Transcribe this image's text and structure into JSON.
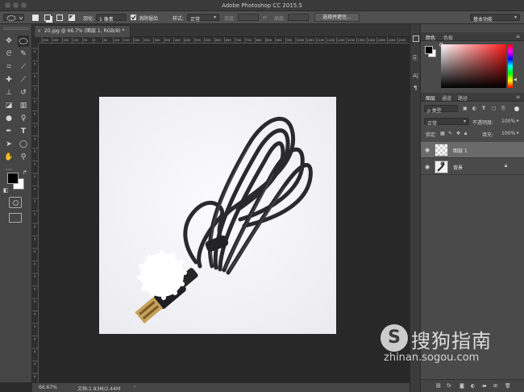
{
  "app": {
    "title": "Adobe Photoshop CC 2015.5"
  },
  "options": {
    "feather_label": "羽化:",
    "feather_value": "1 像素",
    "antialias_label": "消除锯齿",
    "style_label": "样式:",
    "style_value": "正常",
    "width_label": "宽度:",
    "height_label": "高度:",
    "select_mask_button": "选择并遮住...",
    "workspace": "基本功能"
  },
  "document": {
    "tab_title": "20.jpg @ 66.7% (图层 1, RGB/8) *",
    "zoom": "66.67%",
    "doc_info": "文档:1.83M/2.44M"
  },
  "rulers": {
    "top": [
      "250",
      "200",
      "150",
      "100",
      "50",
      "0",
      "50",
      "100",
      "150",
      "200",
      "250",
      "300",
      "350",
      "400",
      "450",
      "500",
      "550",
      "600",
      "650",
      "700",
      "750",
      "800",
      "850",
      "900",
      "950",
      "1000",
      "1050",
      "1100",
      "1150",
      "1200",
      "1250",
      "1300",
      "1350",
      "1400",
      "1450",
      "1500"
    ],
    "left": [
      "0",
      "5",
      "0",
      "1",
      "0",
      "0",
      "1",
      "5",
      "0",
      "2",
      "0",
      "0",
      "2",
      "5",
      "0",
      "3",
      "0",
      "0",
      "3",
      "5",
      "0",
      "4",
      "0",
      "0",
      "4",
      "5",
      "0"
    ]
  },
  "color_panel": {
    "tabs": [
      "颜色",
      "色板"
    ],
    "active": "颜色",
    "foreground": "#000000",
    "background": "#ffffff",
    "hue_color": "#ff1a1a"
  },
  "layers_panel": {
    "tabs": [
      "图层",
      "通道",
      "路径"
    ],
    "filter_label": "ρ 类型",
    "blend_mode": "正常",
    "opacity_label": "不透明度:",
    "opacity_value": "100%",
    "lock_label": "锁定:",
    "fill_label": "填充:",
    "fill_value": "100%",
    "layers": [
      {
        "name": "图层 1",
        "selected": true
      },
      {
        "name": "背景",
        "selected": false,
        "locked": true
      }
    ],
    "footer_icons": [
      "link-icon",
      "fx-icon",
      "mask-icon",
      "adjustment-icon",
      "group-icon",
      "new-layer-icon",
      "trash-icon"
    ]
  },
  "tools": [
    "move-icon",
    "marquee-icon",
    "lasso-icon",
    "quick-select-icon",
    "crop-icon",
    "eyedropper-icon",
    "healing-icon",
    "brush-icon",
    "stamp-icon",
    "history-brush-icon",
    "eraser-icon",
    "gradient-icon",
    "blur-icon",
    "dodge-icon",
    "pen-icon",
    "type-icon",
    "path-select-icon",
    "shape-icon",
    "hand-icon",
    "zoom-icon"
  ],
  "watermark": {
    "brand": "搜狗指南",
    "url": "zhinan.sogou.com"
  }
}
